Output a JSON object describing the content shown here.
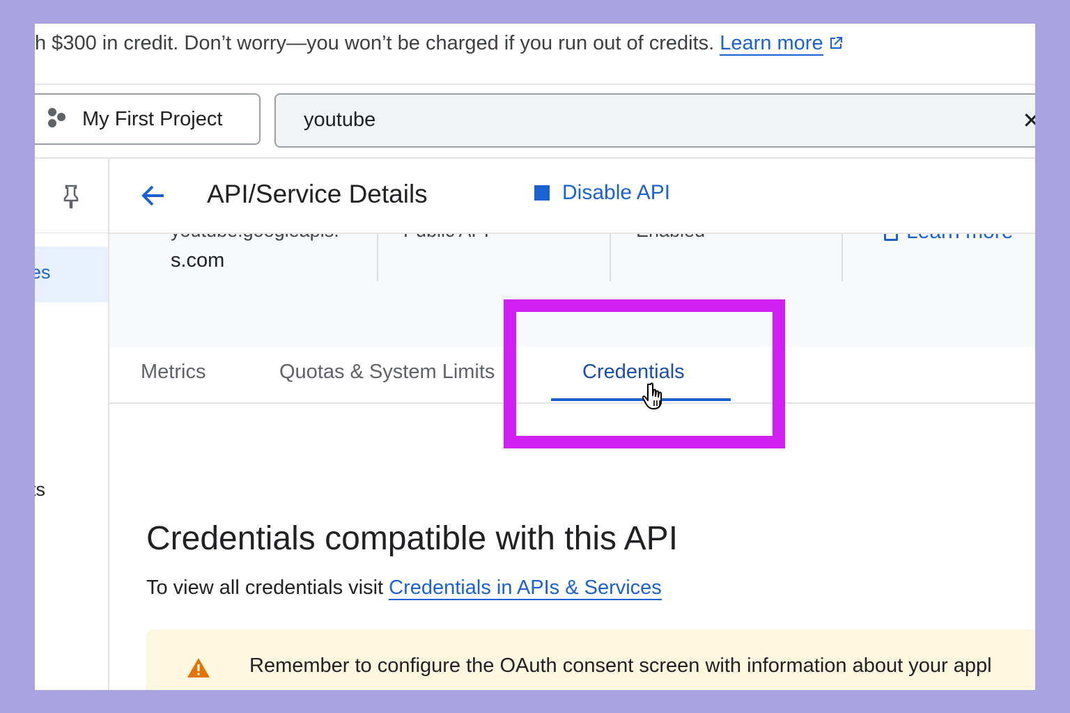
{
  "banner": {
    "text": "h $300 in credit. Don’t worry—you won’t be charged if you run out of credits.",
    "link": "Learn more",
    "link_icon": "open-in-new-icon"
  },
  "topbar": {
    "project_label": "My First Project",
    "project_icon": "project-hexagons-icon",
    "search_value": "youtube",
    "clear_icon": "close-icon"
  },
  "sidebar": {
    "pin_icon": "pin-icon",
    "items": [
      {
        "label": "es",
        "active": true
      },
      {
        "label": "ts",
        "active": false
      }
    ]
  },
  "header": {
    "back_icon": "arrow-back-icon",
    "title": "API/Service Details",
    "disable_label": "Disable API"
  },
  "details": {
    "col1_cut": "youtube.googleapis.",
    "col1_second": "s.com",
    "col2_cut": "Public API",
    "col3_cut": "Enabled",
    "learn_more_cut": "Learn more"
  },
  "tabs": [
    {
      "label": "Metrics",
      "active": false
    },
    {
      "label": "Quotas & System Limits",
      "active": false
    },
    {
      "label": "Credentials",
      "active": true
    }
  ],
  "content": {
    "title": "Credentials compatible with this API",
    "sub_prefix": "To view all credentials visit ",
    "sub_link": "Credentials in APIs & Services",
    "notice": "Remember to configure the OAuth consent screen with information about your appl",
    "notice_icon": "warning-icon"
  },
  "colors": {
    "accent": "#1a62d2",
    "highlight": "#d21ff2",
    "frame_bg": "#a8a2e0",
    "notice_bg": "#fef7e0",
    "warning": "#e37400"
  }
}
